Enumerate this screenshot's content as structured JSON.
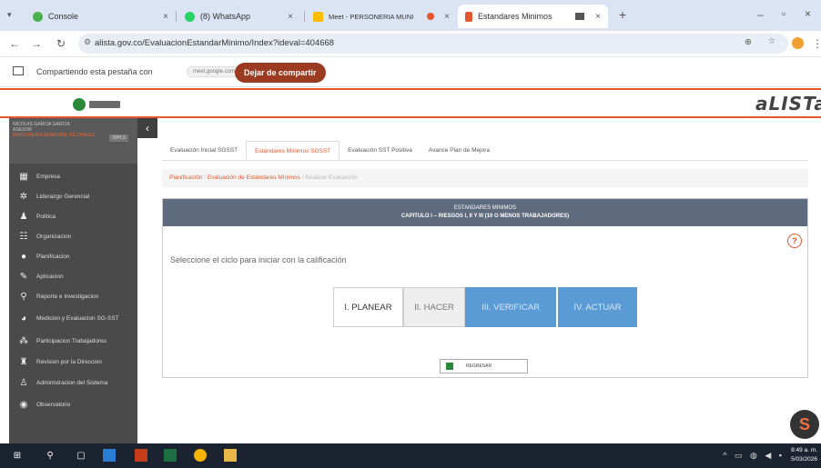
{
  "browser": {
    "tabs": [
      {
        "label": "Console",
        "color": "#4caf50"
      },
      {
        "label": "(8) WhatsApp",
        "color": "#25d366"
      },
      {
        "label": "Meet - PERSONERIA MUNI",
        "color": "#fbbc04"
      },
      {
        "label": "Estandares Minimos",
        "color": "#e2572c"
      }
    ],
    "url": "alista.gov.co/EvaluacionEstandarMinimo/Index?ideval=404668",
    "share_text": "Compartiendo esta pestaña con",
    "share_chip": "meet.google.com",
    "stop_share_label": "Dejar de compartir"
  },
  "sidebar": {
    "user_name": "NICOLAS GARCIA GARCIA",
    "user_role": "ASESOR",
    "user_org": "PERSONERIA MUNICIPAL DE CHAVEZ",
    "user_badge": "20PLS",
    "items": [
      {
        "label": "Empresa",
        "icon": "building-icon"
      },
      {
        "label": "Liderazgo Gerencial",
        "icon": "users-icon"
      },
      {
        "label": "Politica",
        "icon": "person-icon"
      },
      {
        "label": "Organizacion",
        "icon": "org-icon"
      },
      {
        "label": "Planificacion",
        "icon": "plan-icon"
      },
      {
        "label": "Aplicacion",
        "icon": "tool-icon"
      },
      {
        "label": "Reporte e Investigacion",
        "icon": "search-icon"
      },
      {
        "label": "Medicion y Evaluacion SG-SST",
        "icon": "chart-icon"
      },
      {
        "label": "Participacion Trabajadores",
        "icon": "group-icon"
      },
      {
        "label": "Revision por la Direccion",
        "icon": "review-icon"
      },
      {
        "label": "Administracion del Sistema",
        "icon": "admin-icon"
      },
      {
        "label": "Observatorio",
        "icon": "observatory-icon"
      }
    ]
  },
  "main": {
    "subtabs": [
      "Evaluación Inicial SGSST",
      "Estándares Mínimos SGSST",
      "Evaluación SST Positiva",
      "Avance Plan de Mejora"
    ],
    "breadcrumb": [
      "Planificación",
      "Evaluación de Estándares Mínimos",
      "Realizar Evaluación"
    ],
    "panel_title": "ESTANDARES MINIMOS",
    "panel_subtitle": "CAPITULO I – RIESGOS I, II Y III (10 O MENOS TRABAJADORES)",
    "instruction": "Seleccione el ciclo para iniciar con la calificación",
    "cycles": [
      "I. PLANEAR",
      "II. HACER",
      "III. VERIFICAR",
      "IV. ACTUAR"
    ],
    "back_label": "REGRESAR"
  },
  "taskbar": {
    "time": "8:49 a. m.",
    "date": "5/03/2026"
  }
}
